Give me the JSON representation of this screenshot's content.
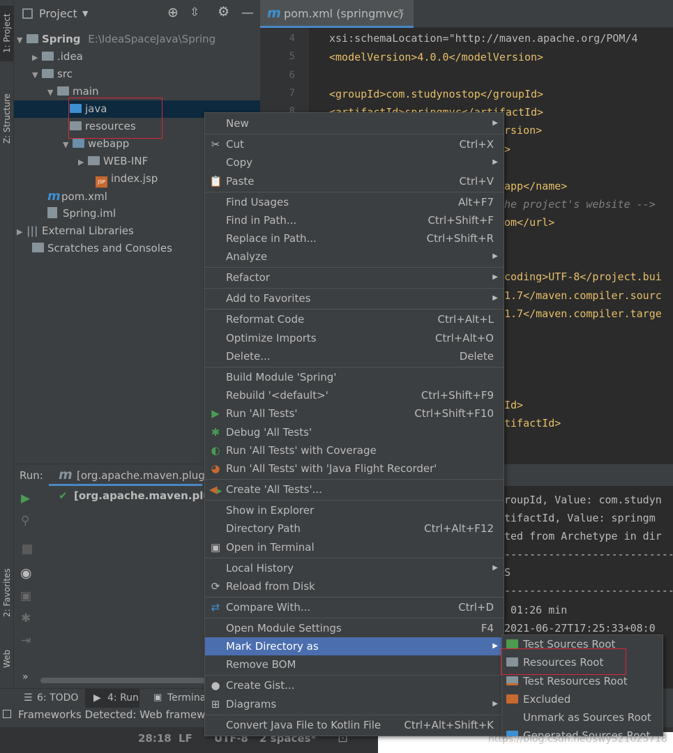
{
  "left_strip": {
    "project_tab": "1: Project",
    "structure_tab": "Z: Structure",
    "favorites_tab": "2: Favorites",
    "web_tab": "Web"
  },
  "project_panel": {
    "title": "Project",
    "tree": [
      {
        "label": "Spring",
        "path": "E:\\IdeaSpaceJava\\Spring"
      },
      {
        "label": ".idea"
      },
      {
        "label": "src"
      },
      {
        "label": "main"
      },
      {
        "label": "java"
      },
      {
        "label": "resources"
      },
      {
        "label": "webapp"
      },
      {
        "label": "WEB-INF"
      },
      {
        "label": "index.jsp"
      },
      {
        "label": "pom.xml"
      },
      {
        "label": "Spring.iml"
      },
      {
        "label": "External Libraries"
      },
      {
        "label": "Scratches and Consoles"
      }
    ]
  },
  "editor": {
    "tab_label": "pom.xml (springmvc)",
    "line_numbers": [
      "4",
      "5",
      "6",
      "7",
      "8"
    ],
    "code_lines": [
      "xsi:schemaLocation=\"http://maven.apache.org/POM/4",
      "<modelVersion>4.0.0</modelVersion>",
      "",
      "<groupId>com.studynostop</groupId>",
      "<artifactId>springmvc</artifactId>",
      "rsion>",
      ">",
      "",
      "app</name>",
      "he project's website -->",
      "om</url>",
      "",
      "",
      "coding>UTF-8</project.bui",
      "1.7</maven.compiler.sourc",
      "1.7</maven.compiler.targe",
      "Id>",
      "tifactId>"
    ]
  },
  "run_panel": {
    "label": "Run:",
    "tab_label": "[org.apache.maven.plugi",
    "tree_item": "[org.apache.maven.plugi",
    "console_lines": [
      "roupId, Value: com.studyn",
      "tifactId, Value: springm",
      "ted from Archetype in dir",
      "----------------------------",
      "S",
      "----------------------------",
      " 01:26 min",
      "2021-06-27T17:25:33+08:0",
      "-----------------------------"
    ]
  },
  "bottom_tabs": {
    "todo": "6: TODO",
    "run": "4: Run",
    "terminal": "Terminal"
  },
  "status_bar": {
    "message": "Frameworks Detected: Web framewo",
    "position": "28:18",
    "line_sep": "LF",
    "encoding": "UTF-8",
    "indent": "2 spaces*"
  },
  "watermark": "https://blog.csdn.net/swy521025718",
  "context_menu": {
    "items": [
      {
        "label": "New",
        "shortcut": ""
      },
      {
        "label": "Cut",
        "shortcut": "Ctrl+X"
      },
      {
        "label": "Copy",
        "shortcut": ""
      },
      {
        "label": "Paste",
        "shortcut": "Ctrl+V"
      },
      {
        "label": "Find Usages",
        "shortcut": "Alt+F7"
      },
      {
        "label": "Find in Path...",
        "shortcut": "Ctrl+Shift+F"
      },
      {
        "label": "Replace in Path...",
        "shortcut": "Ctrl+Shift+R"
      },
      {
        "label": "Analyze",
        "shortcut": ""
      },
      {
        "label": "Refactor",
        "shortcut": ""
      },
      {
        "label": "Add to Favorites",
        "shortcut": ""
      },
      {
        "label": "Reformat Code",
        "shortcut": "Ctrl+Alt+L"
      },
      {
        "label": "Optimize Imports",
        "shortcut": "Ctrl+Alt+O"
      },
      {
        "label": "Delete...",
        "shortcut": "Delete"
      },
      {
        "label": "Build Module 'Spring'",
        "shortcut": ""
      },
      {
        "label": "Rebuild '<default>'",
        "shortcut": "Ctrl+Shift+F9"
      },
      {
        "label": "Run 'All Tests'",
        "shortcut": "Ctrl+Shift+F10"
      },
      {
        "label": "Debug 'All Tests'",
        "shortcut": ""
      },
      {
        "label": "Run 'All Tests' with Coverage",
        "shortcut": ""
      },
      {
        "label": "Run 'All Tests' with 'Java Flight Recorder'",
        "shortcut": ""
      },
      {
        "label": "Create 'All Tests'...",
        "shortcut": ""
      },
      {
        "label": "Show in Explorer",
        "shortcut": ""
      },
      {
        "label": "Directory Path",
        "shortcut": "Ctrl+Alt+F12"
      },
      {
        "label": "Open in Terminal",
        "shortcut": ""
      },
      {
        "label": "Local History",
        "shortcut": ""
      },
      {
        "label": "Reload from Disk",
        "shortcut": ""
      },
      {
        "label": "Compare With...",
        "shortcut": "Ctrl+D"
      },
      {
        "label": "Open Module Settings",
        "shortcut": "F4"
      },
      {
        "label": "Mark Directory as",
        "shortcut": ""
      },
      {
        "label": "Remove BOM",
        "shortcut": ""
      },
      {
        "label": "Create Gist...",
        "shortcut": ""
      },
      {
        "label": "Diagrams",
        "shortcut": ""
      },
      {
        "label": "Convert Java File to Kotlin File",
        "shortcut": "Ctrl+Alt+Shift+K"
      }
    ]
  },
  "submenu": {
    "items": [
      {
        "label": "Test Sources Root",
        "color": "#4e9a4e"
      },
      {
        "label": "Resources Root",
        "color": "#87939a"
      },
      {
        "label": "Test Resources Root",
        "color": "#87939a"
      },
      {
        "label": "Excluded",
        "color": "#c8692f"
      },
      {
        "label": "Unmark as Sources Root",
        "color": ""
      },
      {
        "label": "Generated Sources Root",
        "color": "#3d8fd1"
      }
    ]
  }
}
